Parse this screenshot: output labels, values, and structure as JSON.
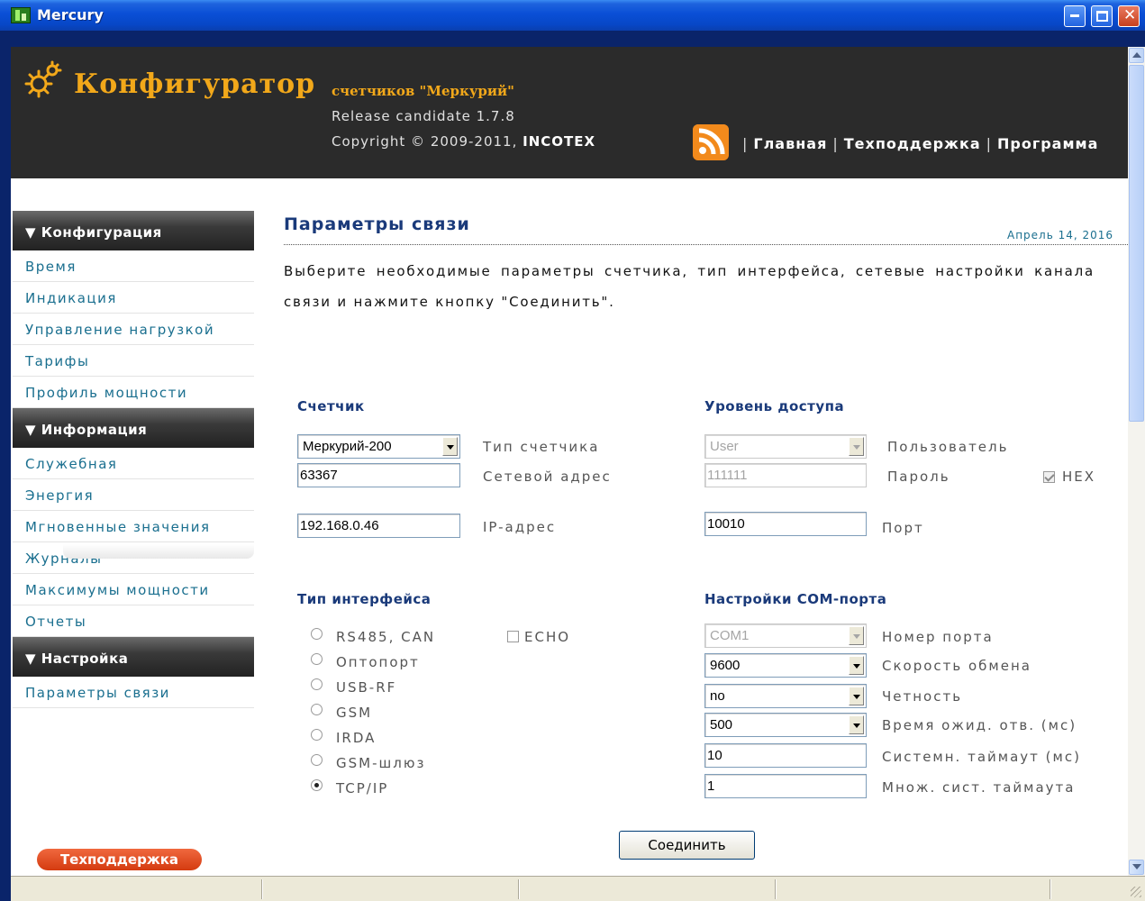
{
  "window": {
    "title": "Mercury",
    "controls": {
      "minimize": "minimize-icon",
      "maximize": "maximize-icon",
      "close": "close-icon"
    }
  },
  "header": {
    "brand": "Конфигуратор",
    "brand_sub": "счетчиков \"Меркурий\"",
    "release": "Release candidate 1.7.8",
    "copyright_prefix": "Copyright © 2009-2011,",
    "copyright_company": "INCOTEX",
    "nav": [
      "Главная",
      "Техподдержка",
      "Программа"
    ],
    "colors": {
      "accent": "#f2a81a",
      "header_bg": "#2b2b2b",
      "rss": "#f28a1c"
    }
  },
  "sidebar": {
    "sections": [
      {
        "title": "▼ Конфигурация",
        "items": [
          "Время",
          "Индикация",
          "Управление нагрузкой",
          "Тарифы",
          "Профиль мощности"
        ]
      },
      {
        "title": "▼ Информация",
        "items": [
          "Служебная",
          "Энергия",
          "Мгновенные значения",
          "Журналы",
          "Максимумы мощности",
          "Отчеты"
        ]
      },
      {
        "title": "▼ Настройка",
        "items": [
          "Параметры связи"
        ]
      }
    ],
    "support_button": "Техподдержка"
  },
  "main": {
    "title": "Параметры связи",
    "date": "Апрель 14, 2016",
    "intro": "Выберите необходимые параметры счетчика, тип интерфейса, сетевые настройки канала связи и нажмите кнопку \"Соединить\".",
    "counter": {
      "title": "Счетчик",
      "meter_type_value": "Меркурий-200",
      "meter_type_label": "Тип счетчика",
      "net_address_value": "63367",
      "net_address_label": "Сетевой адрес",
      "ip_value": "192.168.0.46",
      "ip_label": "IP-адрес"
    },
    "access": {
      "title": "Уровень доступа",
      "user_value": "User",
      "user_label": "Пользователь",
      "password_value": "111111",
      "password_label": "Пароль",
      "hex_label": "HEX",
      "hex_checked": true,
      "port_value": "10010",
      "port_label": "Порт"
    },
    "interface": {
      "title": "Тип интерфейса",
      "options": [
        "RS485, CAN",
        "Оптопорт",
        "USB-RF",
        "GSM",
        "IRDA",
        "GSM-шлюз",
        "TCP/IP"
      ],
      "selected": "TCP/IP",
      "echo_label": "ECHO",
      "echo_checked": false
    },
    "com_port": {
      "title": "Настройки COM-порта",
      "rows": [
        {
          "value": "COM1",
          "label": "Номер порта",
          "type": "select",
          "disabled": true
        },
        {
          "value": "9600",
          "label": "Скорость обмена",
          "type": "select",
          "disabled": false
        },
        {
          "value": "no",
          "label": "Четность",
          "type": "select",
          "disabled": false
        },
        {
          "value": "500",
          "label": "Время ожид. отв. (мс)",
          "type": "select",
          "disabled": false
        },
        {
          "value": "10",
          "label": "Системн. таймаут (мс)",
          "type": "input",
          "disabled": false
        },
        {
          "value": "1",
          "label": "Множ. сист. таймаута",
          "type": "input",
          "disabled": false
        }
      ]
    },
    "connect_button": "Соединить"
  }
}
